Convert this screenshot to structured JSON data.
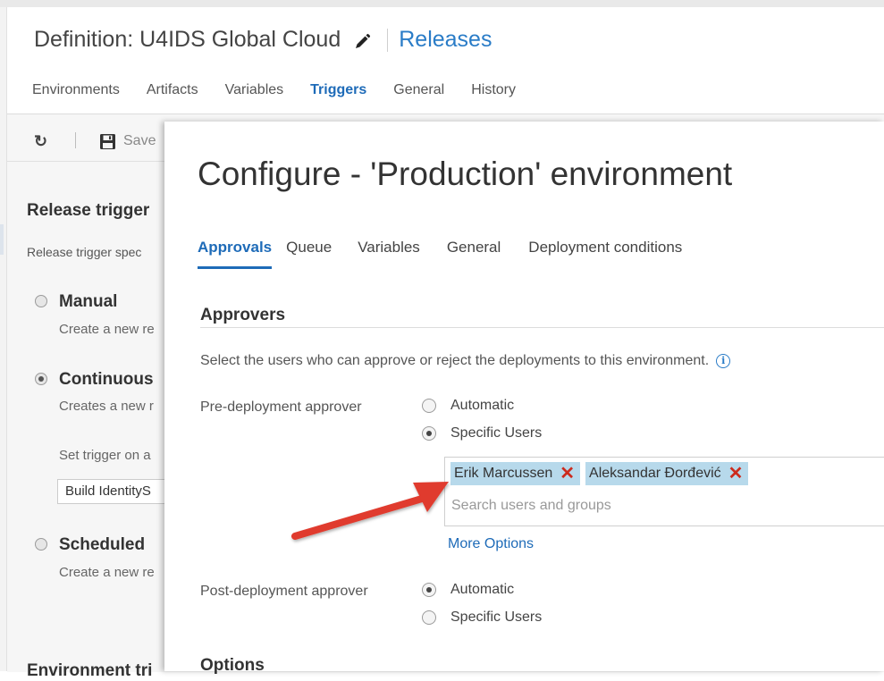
{
  "header": {
    "title": "Definition: U4IDS Global Cloud",
    "breadcrumb_link": "Releases",
    "tabs": [
      {
        "label": "Environments"
      },
      {
        "label": "Artifacts"
      },
      {
        "label": "Variables"
      },
      {
        "label": "Triggers",
        "active": true
      },
      {
        "label": "General"
      },
      {
        "label": "History"
      }
    ]
  },
  "toolbar": {
    "refresh_icon": "refresh-icon",
    "save_label": "Save"
  },
  "background_panel": {
    "release_trigger_heading": "Release trigger",
    "release_trigger_desc": "Release trigger spec",
    "options": [
      {
        "label": "Manual",
        "desc": "Create a new re",
        "selected": false
      },
      {
        "label": "Continuous",
        "desc": "Creates a new r",
        "selected": true
      },
      {
        "label": "Scheduled",
        "desc": "Create a new re",
        "selected": false
      }
    ],
    "set_trigger_text": "Set trigger on a",
    "build_value": "Build IdentityS",
    "environment_trigger_heading": "Environment tri"
  },
  "modal": {
    "title": "Configure - 'Production' environment",
    "tabs": [
      {
        "label": "Approvals",
        "active": true
      },
      {
        "label": "Queue"
      },
      {
        "label": "Variables"
      },
      {
        "label": "General"
      },
      {
        "label": "Deployment conditions"
      }
    ],
    "approvers_heading": "Approvers",
    "approvers_description": "Select the users who can approve or reject the deployments to this environment.",
    "pre_deployment": {
      "label": "Pre-deployment approver",
      "options": [
        {
          "label": "Automatic",
          "selected": false
        },
        {
          "label": "Specific Users",
          "selected": true
        }
      ],
      "approvers": [
        "Erik Marcussen",
        "Aleksandar Đorđević"
      ],
      "search_placeholder": "Search users and groups",
      "more_options": "More Options"
    },
    "post_deployment": {
      "label": "Post-deployment approver",
      "options": [
        {
          "label": "Automatic",
          "selected": true
        },
        {
          "label": "Specific Users",
          "selected": false
        }
      ]
    },
    "options_heading": "Options"
  },
  "colors": {
    "accent": "#1e6bb8",
    "link": "#2a7cc7",
    "chip_bg": "#b7d9eb",
    "remove_x": "#cc2b1d",
    "annotation_arrow": "#e03a2e"
  }
}
